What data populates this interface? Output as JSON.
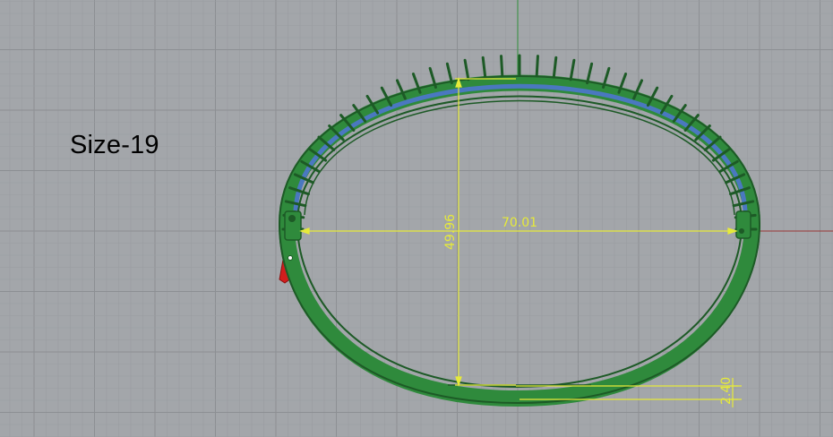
{
  "viewport": {
    "size_label": "Size-19",
    "dimensions": {
      "width_label": "70.01",
      "height_label": "49.96",
      "thickness_label": "2.40"
    }
  },
  "colors": {
    "background": "#a3a6aa",
    "grid_minor": "#999ca0",
    "grid_major": "#8c8f93",
    "axis_y": "#2f8f3b",
    "axis_x": "#9a3636",
    "bangle_green": "#2f8a3c",
    "bangle_dark": "#1d5a26",
    "bangle_blue": "#4a78c0",
    "clasp_red": "#d11d1d",
    "dimension": "#e6ea3a"
  }
}
